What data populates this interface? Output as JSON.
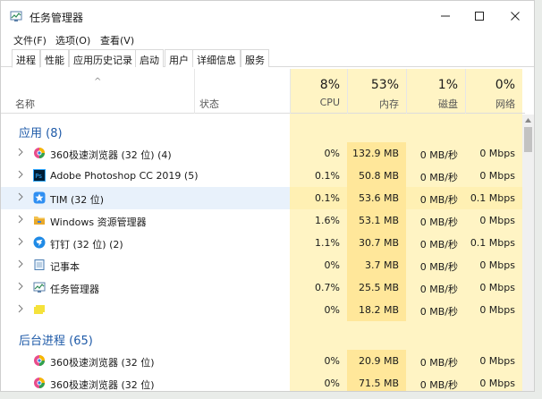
{
  "window": {
    "title": "任务管理器"
  },
  "menu": [
    "文件(F)",
    "选项(O)",
    "查看(V)"
  ],
  "tabs": [
    "进程",
    "性能",
    "应用历史记录",
    "启动",
    "用户",
    "详细信息",
    "服务"
  ],
  "header": {
    "name": "名称",
    "status": "状态",
    "cpu": {
      "pct": "8%",
      "label": "CPU"
    },
    "mem": {
      "pct": "53%",
      "label": "内存"
    },
    "disk": {
      "pct": "1%",
      "label": "磁盘"
    },
    "net": {
      "pct": "0%",
      "label": "网络"
    }
  },
  "groups": {
    "apps": "应用 (8)",
    "background": "后台进程 (65)"
  },
  "apps": [
    {
      "name": "360极速浏览器 (32 位) (4)",
      "cpu": "0%",
      "mem": "132.9 MB",
      "disk": "0 MB/秒",
      "net": "0 Mbps",
      "icon": "browser-360-icon"
    },
    {
      "name": "Adobe Photoshop CC 2019 (5)",
      "cpu": "0.1%",
      "mem": "50.8 MB",
      "disk": "0 MB/秒",
      "net": "0 Mbps",
      "icon": "photoshop-icon"
    },
    {
      "name": "TIM (32 位)",
      "cpu": "0.1%",
      "mem": "53.6 MB",
      "disk": "0 MB/秒",
      "net": "0.1 Mbps",
      "icon": "tim-icon"
    },
    {
      "name": "Windows 资源管理器",
      "cpu": "1.6%",
      "mem": "53.1 MB",
      "disk": "0 MB/秒",
      "net": "0 Mbps",
      "icon": "folder-icon"
    },
    {
      "name": "钉钉 (32 位) (2)",
      "cpu": "1.1%",
      "mem": "30.7 MB",
      "disk": "0 MB/秒",
      "net": "0.1 Mbps",
      "icon": "dingtalk-icon"
    },
    {
      "name": "记事本",
      "cpu": "0%",
      "mem": "3.7 MB",
      "disk": "0 MB/秒",
      "net": "0 Mbps",
      "icon": "notepad-icon"
    },
    {
      "name": "任务管理器",
      "cpu": "0.7%",
      "mem": "25.5 MB",
      "disk": "0 MB/秒",
      "net": "0 Mbps",
      "icon": "task-manager-icon"
    },
    {
      "name": "",
      "cpu": "0%",
      "mem": "18.2 MB",
      "disk": "0 MB/秒",
      "net": "0 Mbps",
      "icon": "yellow-app-icon"
    }
  ],
  "background": [
    {
      "name": "360极速浏览器 (32 位)",
      "cpu": "0%",
      "mem": "20.9 MB",
      "disk": "0 MB/秒",
      "net": "0 Mbps",
      "icon": "browser-360-icon"
    },
    {
      "name": "360极速浏览器 (32 位)",
      "cpu": "0%",
      "mem": "71.5 MB",
      "disk": "0 MB/秒",
      "net": "0 Mbps",
      "icon": "browser-360-icon"
    }
  ],
  "colors": {
    "heat_light": "#fff4c4",
    "heat_mem": "#ffe79a",
    "group_text": "#1e5aa8",
    "selected_row": "#e8f1fb"
  }
}
